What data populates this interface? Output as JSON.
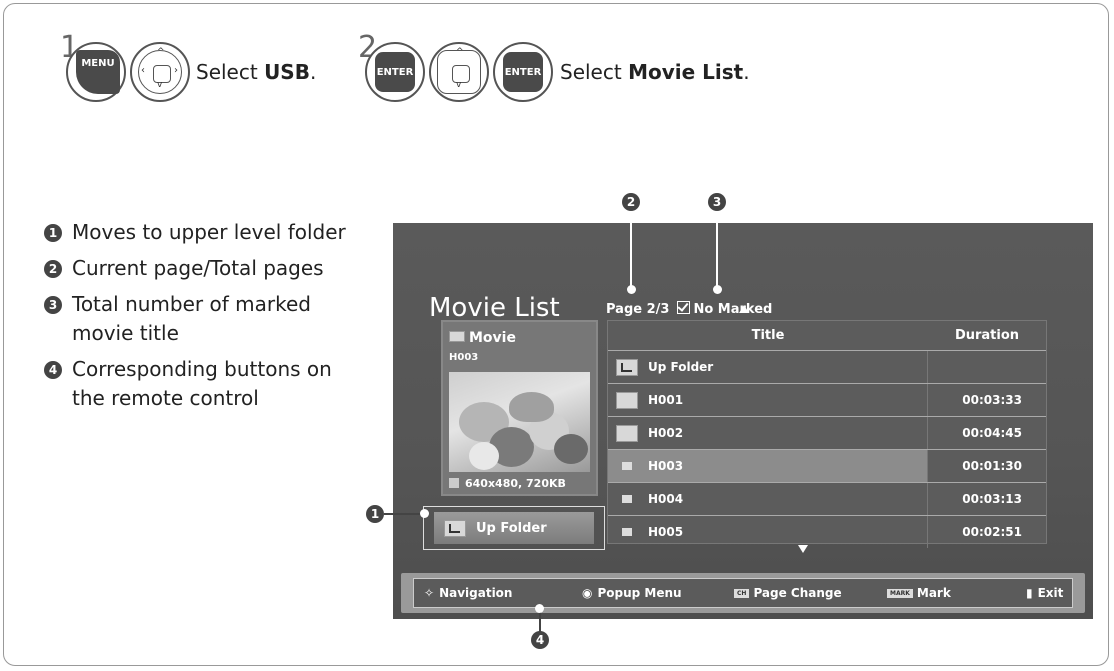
{
  "steps": [
    {
      "num": "1",
      "text_prefix": "Select ",
      "text_bold": "USB",
      "text_suffix": "."
    },
    {
      "num": "2",
      "text_prefix": "Select ",
      "text_bold": "Movie List",
      "text_suffix": "."
    }
  ],
  "buttons": {
    "menu": "MENU",
    "enter": "ENTER"
  },
  "legend": [
    {
      "num": "1",
      "text": "Moves to upper level folder"
    },
    {
      "num": "2",
      "text": "Current page/Total pages"
    },
    {
      "num": "3",
      "text": "Total number of marked movie title"
    },
    {
      "num": "4",
      "text": "Corresponding buttons on the remote control"
    }
  ],
  "screen": {
    "title": "Movie List",
    "page_info": "Page 2/3",
    "marked": "No Marked",
    "preview": {
      "folder": "Movie",
      "file": "H003",
      "resolution": "640x480, 720KB"
    },
    "up_folder_button": "Up Folder",
    "table": {
      "headers": [
        "Title",
        "Duration"
      ],
      "rows": [
        {
          "title": "Up Folder",
          "duration": "",
          "type": "up"
        },
        {
          "title": "H001",
          "duration": "00:03:33",
          "type": "folder"
        },
        {
          "title": "H002",
          "duration": "00:04:45",
          "type": "folder"
        },
        {
          "title": "H003",
          "duration": "00:01:30",
          "type": "movie",
          "selected": true
        },
        {
          "title": "H004",
          "duration": "00:03:13",
          "type": "movie"
        },
        {
          "title": "H005",
          "duration": "00:02:51",
          "type": "movie"
        }
      ]
    },
    "bottom_bar": {
      "navigation": "Navigation",
      "popup": "Popup Menu",
      "page_change": "Page Change",
      "ch_tag": "CH",
      "mark_tag": "MARK",
      "mark": "Mark",
      "exit": "Exit"
    }
  },
  "callouts": [
    "1",
    "2",
    "3",
    "4"
  ]
}
